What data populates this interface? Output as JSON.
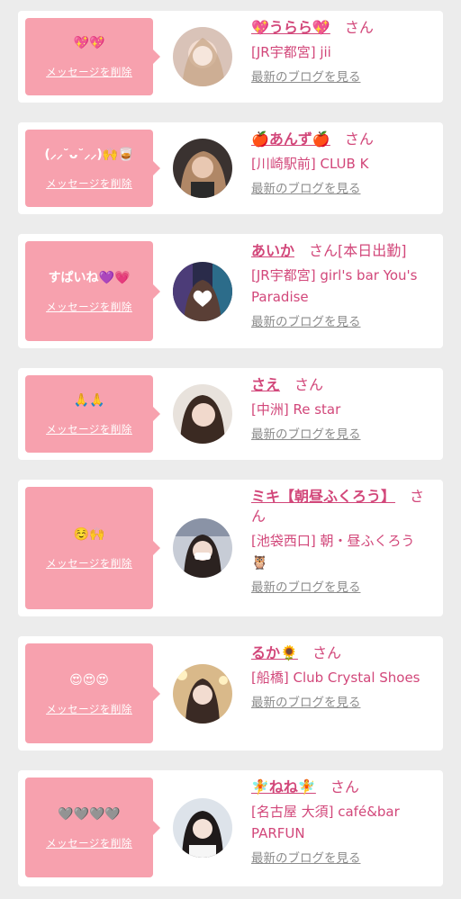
{
  "colors": {
    "bubble": "#f7a1ae",
    "accent": "#d2477a",
    "link": "#8c8c8c"
  },
  "delete_label": "メッセージを削除",
  "blog_label": "最新のブログを見る",
  "san": "さん",
  "cards": [
    {
      "message": "💖💖",
      "name": "💖うらら💖",
      "store": "[JR宇都宮] jii",
      "avatar": "avatar-photo"
    },
    {
      "message": "(⸝⸝˘ᴗ˘⸝⸝)🙌🥃",
      "name": "🍎あんず🍎",
      "store": "[川崎駅前] CLUB K",
      "avatar": "avatar-photo"
    },
    {
      "message": "すぱいね💜💗",
      "name": "あいか",
      "name_suffix": "さん[本日出勤]",
      "store": "[JR宇都宮] girl's bar You's Paradise",
      "avatar": "avatar-photo"
    },
    {
      "message": "🙏🙏",
      "name": "さえ",
      "store": "[中洲] Re star",
      "avatar": "avatar-photo"
    },
    {
      "message": "☺️🙌",
      "name": "ミキ【朝昼ふくろう】",
      "store": "[池袋西口] 朝・昼ふくろう🦉",
      "avatar": "avatar-photo"
    },
    {
      "message": "😍😍😍",
      "name": "るか🌻",
      "store": "[船橋] Club Crystal Shoes",
      "avatar": "avatar-photo"
    },
    {
      "message": "🩶🩶🩶🩶",
      "name": "🧚ねね🧚",
      "store": "[名古屋 大須] café&bar PARFUN",
      "avatar": "avatar-photo"
    }
  ]
}
